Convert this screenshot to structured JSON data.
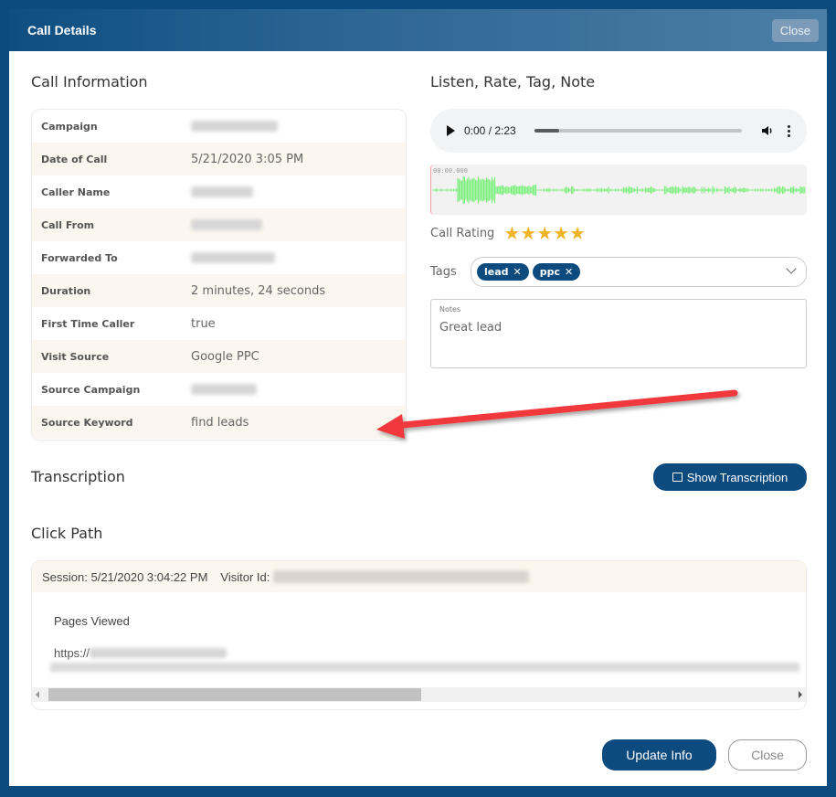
{
  "modal": {
    "title": "Call Details",
    "header_close_label": "Close"
  },
  "call_info": {
    "title": "Call Information",
    "rows": [
      {
        "label": "Campaign",
        "value": "",
        "redacted": true
      },
      {
        "label": "Date of Call",
        "value": "5/21/2020 3:05 PM",
        "redacted": false
      },
      {
        "label": "Caller Name",
        "value": "",
        "redacted": true
      },
      {
        "label": "Call From",
        "value": "",
        "redacted": true
      },
      {
        "label": "Forwarded To",
        "value": "",
        "redacted": true
      },
      {
        "label": "Duration",
        "value": "2 minutes, 24 seconds",
        "redacted": false
      },
      {
        "label": "First Time Caller",
        "value": "true",
        "redacted": false
      },
      {
        "label": "Visit Source",
        "value": "Google PPC",
        "redacted": false
      },
      {
        "label": "Source Campaign",
        "value": "",
        "redacted": true
      },
      {
        "label": "Source Keyword",
        "value": "find leads",
        "redacted": false
      }
    ]
  },
  "listen": {
    "title": "Listen, Rate, Tag, Note",
    "audio": {
      "time_display": "0:00 / 2:23",
      "progress_fraction": 0.12,
      "play_icon": "play-icon",
      "volume_icon": "volume-icon",
      "more_icon": "more-vert-icon"
    },
    "waveform": {
      "timestamp": "00:00.000",
      "color": "#7ef07e"
    },
    "rating": {
      "label": "Call Rating",
      "value": 5,
      "max": 5,
      "color": "#f0b429"
    },
    "tags": {
      "label": "Tags",
      "items": [
        "lead",
        "ppc"
      ],
      "remove_glyph": "✕"
    },
    "notes": {
      "label": "Notes",
      "value": "Great lead"
    }
  },
  "transcription": {
    "title": "Transcription",
    "button_label": "Show Transcription"
  },
  "click_path": {
    "title": "Click Path",
    "session_label": "Session: 5/21/2020 3:04:22 PM",
    "visitor_label": "Visitor Id:",
    "pages_viewed_label": "Pages Viewed",
    "url_prefix": "https://"
  },
  "footer": {
    "update_label": "Update Info",
    "close_label": "Close"
  },
  "colors": {
    "brand": "#0d4a7e",
    "row_alt": "#fcf7ee",
    "annotation_arrow": "#f0393c"
  }
}
